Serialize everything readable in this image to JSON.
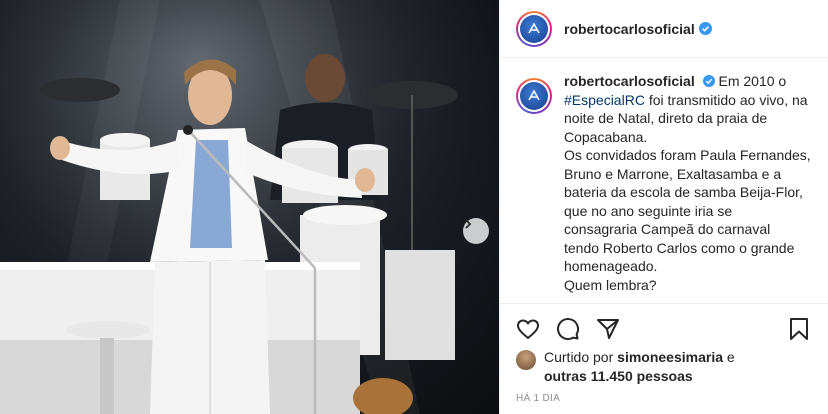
{
  "post": {
    "username": "robertocarlosoficial",
    "verified": true
  },
  "caption": {
    "username": "robertocarlosoficial",
    "line1_before": "Em 2010 o",
    "hashtag": "#EspecialRC",
    "line2_after": "foi transmitido ao vivo, na",
    "line3": "noite de Natal, direto da praia de",
    "line4": "Copacabana.",
    "line5": "Os convidados foram Paula Fernandes,",
    "line6": "Bruno e Marrone, Exaltasamba e a",
    "line7": "bateria da escola de samba Beija-Flor,",
    "line8": "que no ano seguinte iria se",
    "line9": "consagraria Campeã do carnaval",
    "line10": "tendo Roberto Carlos como o grande",
    "line11": "homenageado.",
    "line12": "Quem lembra?"
  },
  "actions": {
    "like_icon": "heart-icon",
    "comment_icon": "comment-icon",
    "share_icon": "share-icon",
    "save_icon": "bookmark-icon"
  },
  "likes": {
    "prefix": "Curtido por",
    "liker": "simoneesimaria",
    "connector": "e",
    "others": "outras 11.450 pessoas"
  },
  "timestamp": "HÁ 1 DIA",
  "colors": {
    "verified": "#3897f0",
    "hashtag": "#00376b",
    "muted": "#8e8e8e"
  }
}
